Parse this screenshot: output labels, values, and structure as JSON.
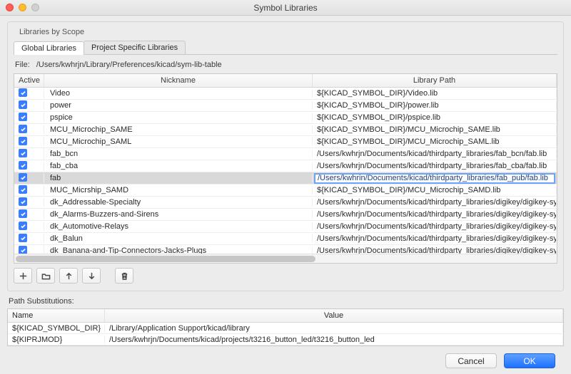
{
  "window": {
    "title": "Symbol Libraries"
  },
  "group_label": "Libraries by Scope",
  "tabs": {
    "global": "Global Libraries",
    "project": "Project Specific Libraries"
  },
  "file": {
    "label": "File:",
    "path": "/Users/kwhrjn/Library/Preferences/kicad/sym-lib-table"
  },
  "headers": {
    "active": "Active",
    "nickname": "Nickname",
    "path": "Library Path"
  },
  "rows": [
    {
      "active": true,
      "nickname": "Video",
      "path": "${KICAD_SYMBOL_DIR}/Video.lib",
      "selected": false
    },
    {
      "active": true,
      "nickname": "power",
      "path": "${KICAD_SYMBOL_DIR}/power.lib",
      "selected": false
    },
    {
      "active": true,
      "nickname": "pspice",
      "path": "${KICAD_SYMBOL_DIR}/pspice.lib",
      "selected": false
    },
    {
      "active": true,
      "nickname": "MCU_Microchip_SAME",
      "path": "${KICAD_SYMBOL_DIR}/MCU_Microchip_SAME.lib",
      "selected": false
    },
    {
      "active": true,
      "nickname": "MCU_Microchip_SAML",
      "path": "${KICAD_SYMBOL_DIR}/MCU_Microchip_SAML.lib",
      "selected": false
    },
    {
      "active": true,
      "nickname": "fab_bcn",
      "path": "/Users/kwhrjn/Documents/kicad/thirdparty_libraries/fab_bcn/fab.lib",
      "selected": false
    },
    {
      "active": true,
      "nickname": "fab_cba",
      "path": "/Users/kwhrjn/Documents/kicad/thirdparty_libraries/fab_cba/fab.lib",
      "selected": false
    },
    {
      "active": true,
      "nickname": "fab",
      "path": "/Users/kwhrin/Documents/kicad/thirdparty_libraries/fab_pub/fab.lib",
      "selected": true,
      "editing": true
    },
    {
      "active": true,
      "nickname": "MUC_Micrship_SAMD",
      "path": "${KICAD_SYMBOL_DIR}/MCU_Microchip_SAMD.lib",
      "selected": false
    },
    {
      "active": true,
      "nickname": "dk_Addressable-Specialty",
      "path": "/Users/kwhrjn/Documents/kicad/thirdparty_libraries/digikey/digikey-symbols/dk_Add",
      "selected": false
    },
    {
      "active": true,
      "nickname": "dk_Alarms-Buzzers-and-Sirens",
      "path": "/Users/kwhrjn/Documents/kicad/thirdparty_libraries/digikey/digikey-symbols/dk_Ala",
      "selected": false
    },
    {
      "active": true,
      "nickname": "dk_Automotive-Relays",
      "path": "/Users/kwhrjn/Documents/kicad/thirdparty_libraries/digikey/digikey-symbols/dk_Aut",
      "selected": false
    },
    {
      "active": true,
      "nickname": "dk_Balun",
      "path": "/Users/kwhrjn/Documents/kicad/thirdparty_libraries/digikey/digikey-symbols/dk_Bal",
      "selected": false
    },
    {
      "active": true,
      "nickname": "dk_Banana-and-Tip-Connectors-Jacks-Plugs",
      "path": "/Users/kwhrjn/Documents/kicad/thirdparty_libraries/digikey/digikey-symbols/dk_Ban",
      "selected": false
    }
  ],
  "subs": {
    "label": "Path Substitutions:",
    "headers": {
      "name": "Name",
      "value": "Value"
    },
    "rows": [
      {
        "name": "${KICAD_SYMBOL_DIR}",
        "value": "/Library/Application Support/kicad/library"
      },
      {
        "name": "${KIPRJMOD}",
        "value": "/Users/kwhrjn/Documents/kicad/projects/t3216_button_led/t3216_button_led"
      }
    ]
  },
  "footer": {
    "cancel": "Cancel",
    "ok": "OK"
  }
}
